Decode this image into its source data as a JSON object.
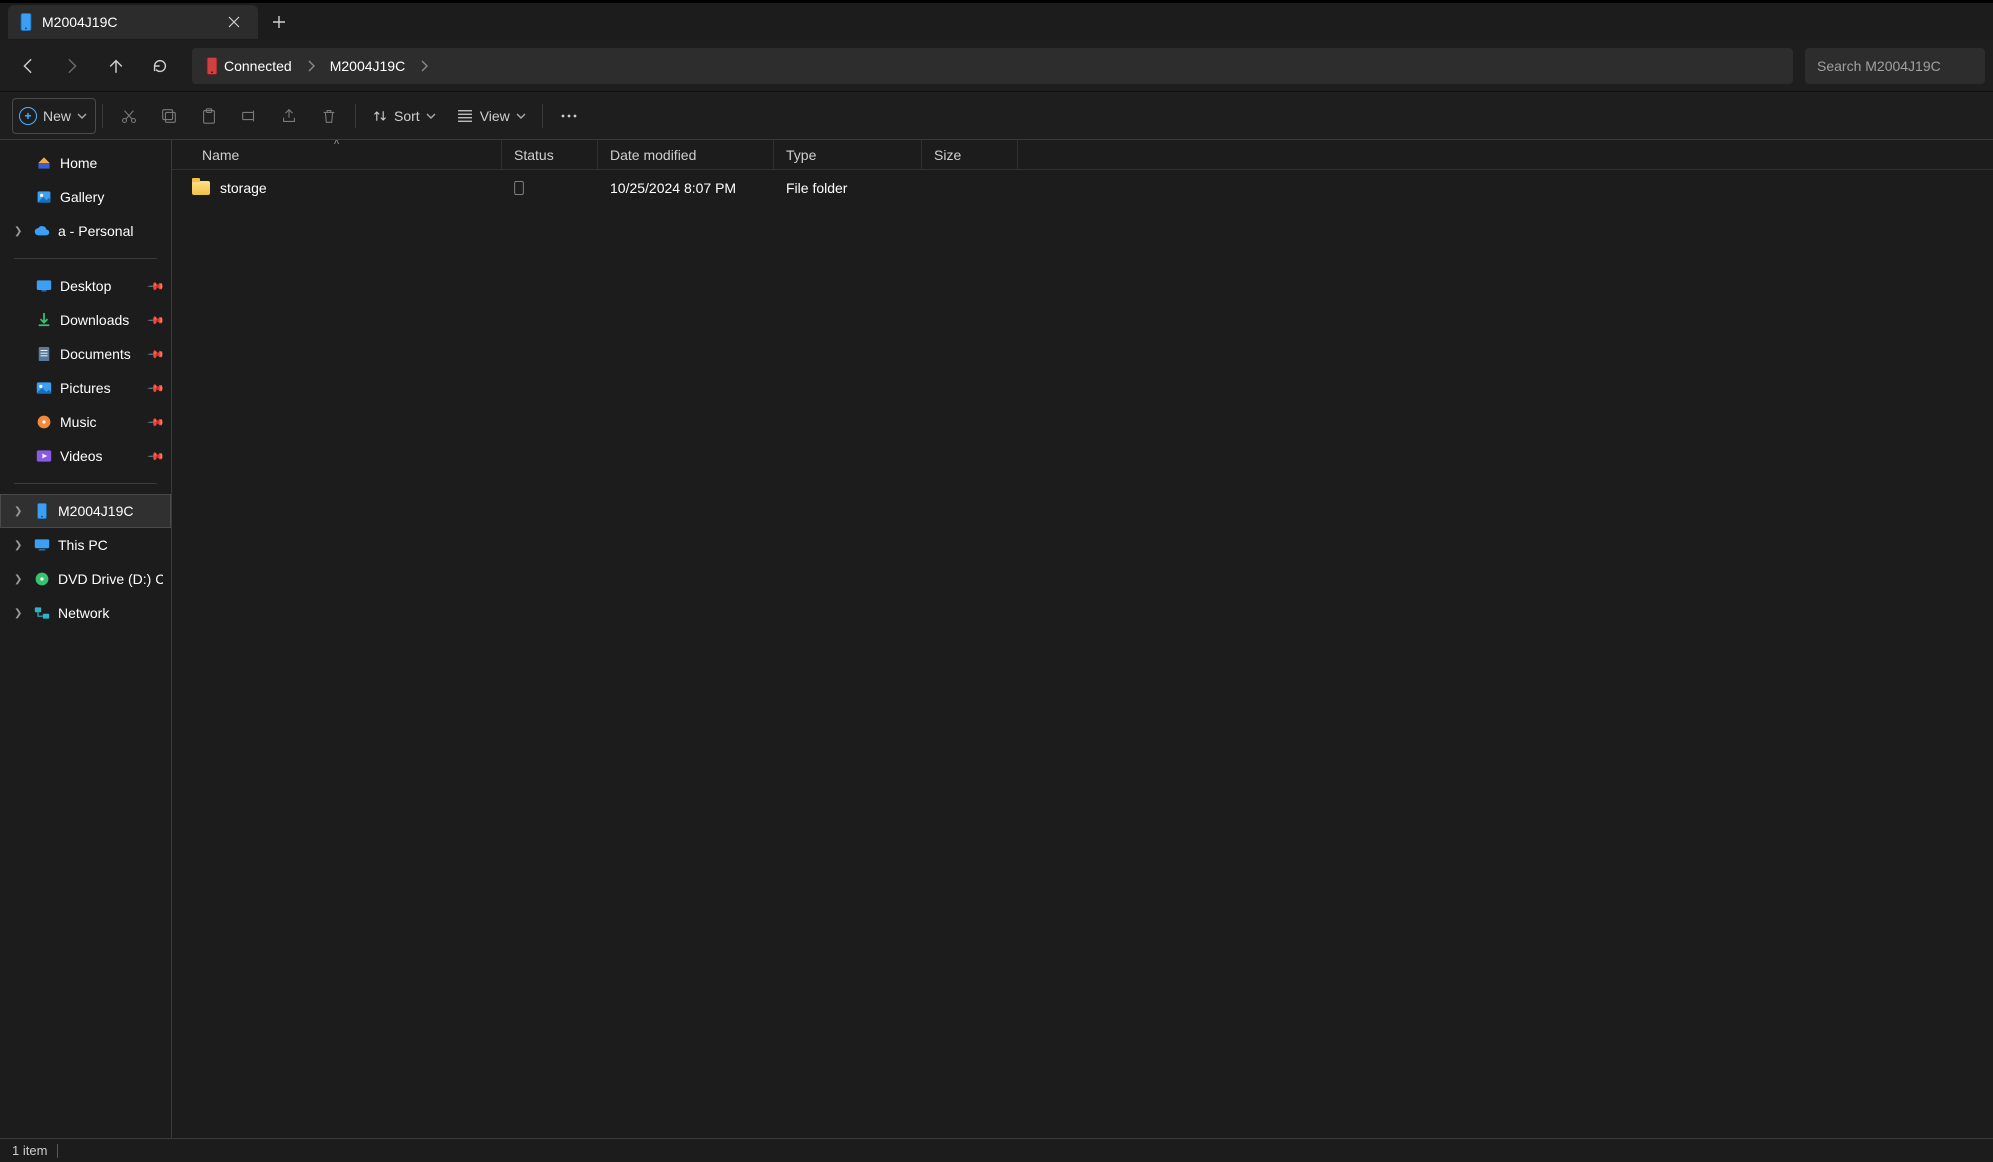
{
  "tab": {
    "title": "M2004J19C"
  },
  "toolbar": {
    "new_label": "New",
    "sort_label": "Sort",
    "view_label": "View"
  },
  "breadcrumb": {
    "root": "Connected",
    "parts": [
      "M2004J19C"
    ]
  },
  "search": {
    "placeholder": "Search M2004J19C"
  },
  "sidebar": {
    "top": [
      {
        "label": "Home",
        "icon": "home"
      },
      {
        "label": "Gallery",
        "icon": "gallery"
      },
      {
        "label": "a - Personal",
        "icon": "onedrive",
        "expandable": true
      }
    ],
    "quick": [
      {
        "label": "Desktop",
        "icon": "desktop",
        "pinned": true
      },
      {
        "label": "Downloads",
        "icon": "downloads",
        "pinned": true
      },
      {
        "label": "Documents",
        "icon": "documents",
        "pinned": true
      },
      {
        "label": "Pictures",
        "icon": "pictures",
        "pinned": true
      },
      {
        "label": "Music",
        "icon": "music",
        "pinned": true
      },
      {
        "label": "Videos",
        "icon": "videos",
        "pinned": true
      }
    ],
    "bottom": [
      {
        "label": "M2004J19C",
        "icon": "phone",
        "expandable": true,
        "selected": true
      },
      {
        "label": "This PC",
        "icon": "thispc",
        "expandable": true
      },
      {
        "label": "DVD Drive (D:) CCC",
        "icon": "dvd",
        "expandable": true
      },
      {
        "label": "Network",
        "icon": "network",
        "expandable": true
      }
    ]
  },
  "columns": {
    "name": "Name",
    "status": "Status",
    "date": "Date modified",
    "type": "Type",
    "size": "Size"
  },
  "items": [
    {
      "name": "storage",
      "status": "📱",
      "date": "10/25/2024 8:07 PM",
      "type": "File folder",
      "size": ""
    }
  ],
  "statusbar": {
    "text": "1 item"
  }
}
